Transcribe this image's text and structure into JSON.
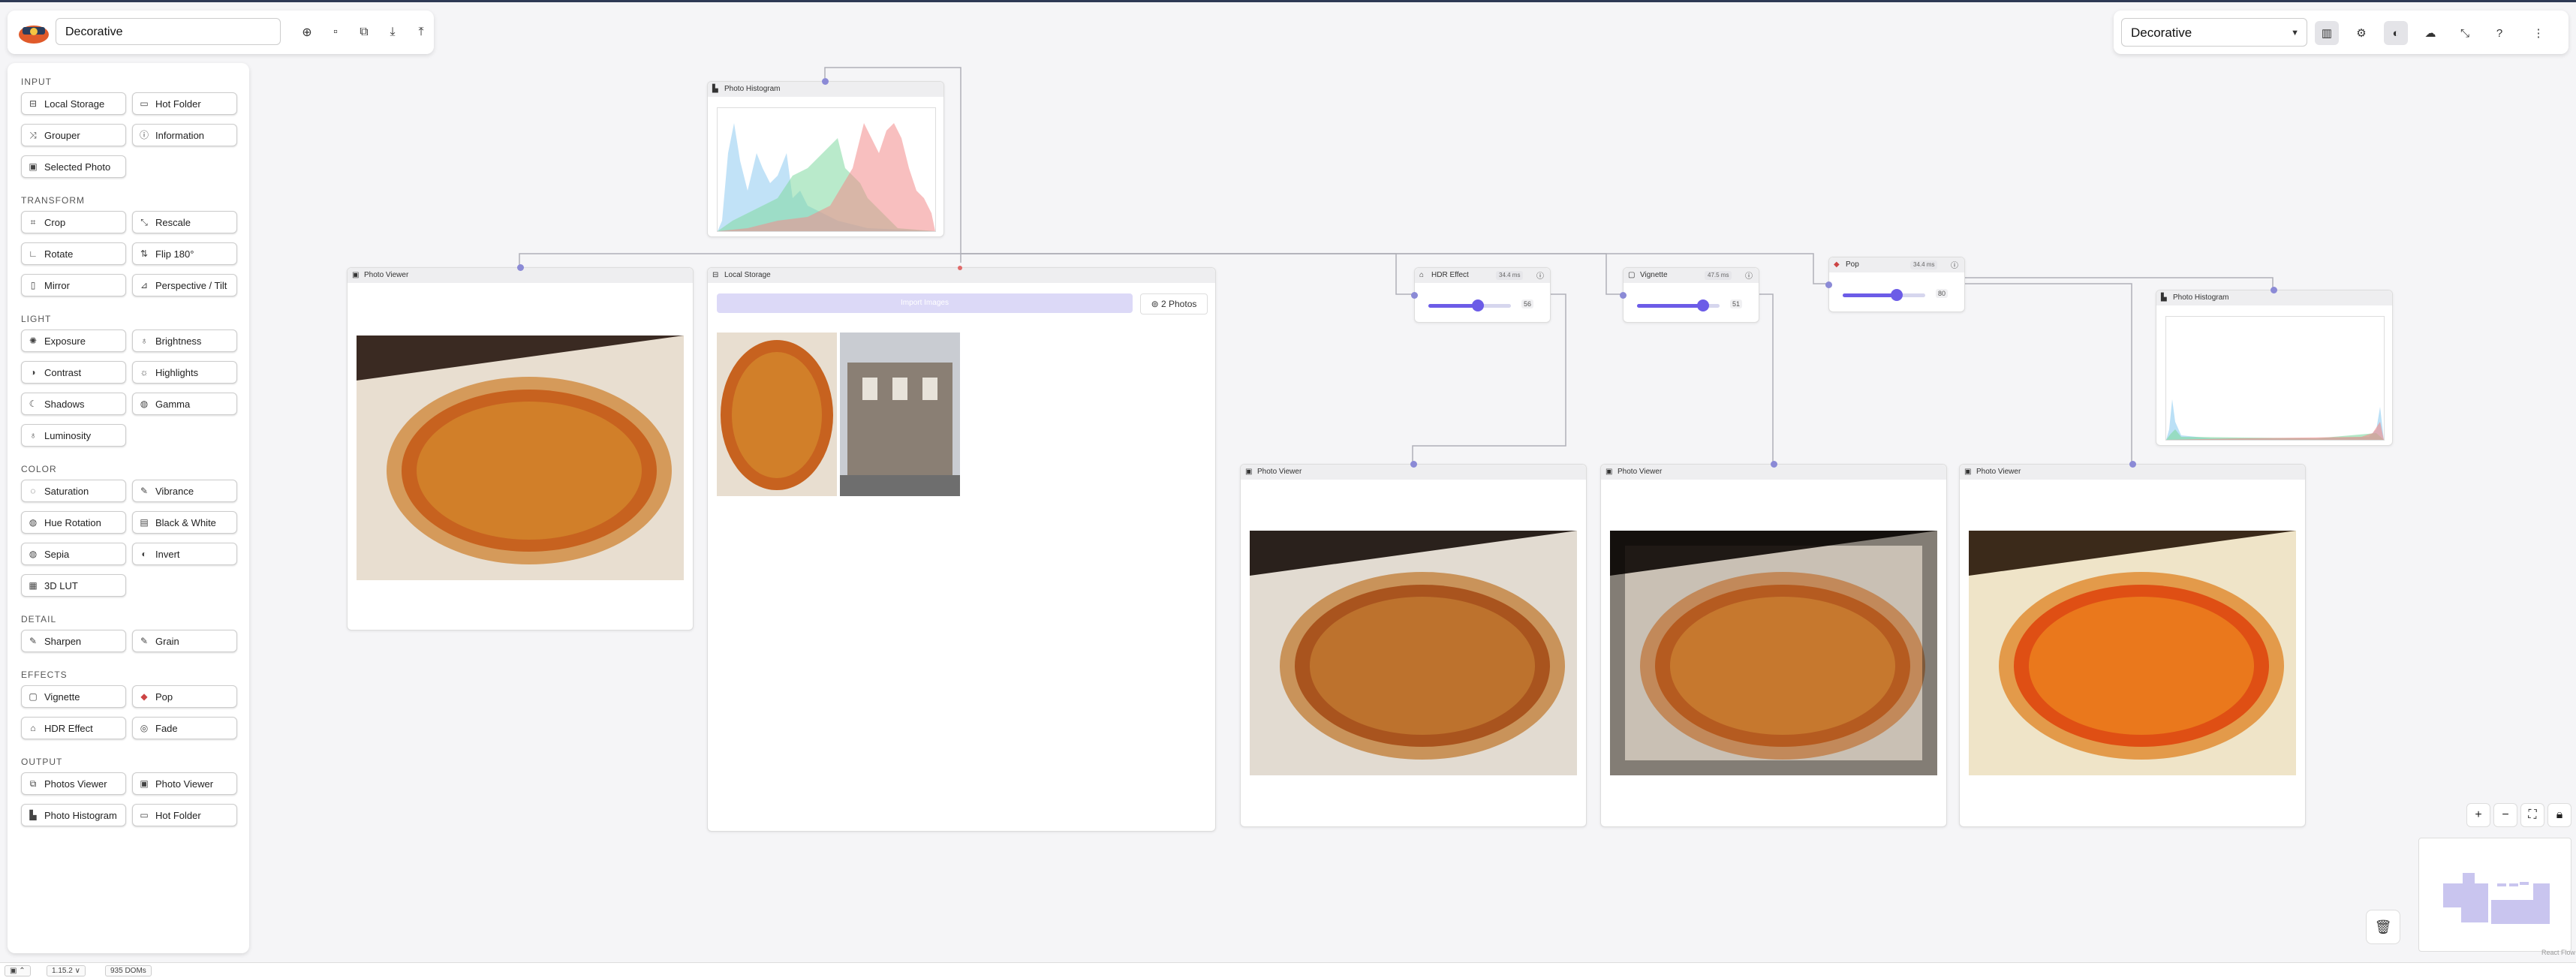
{
  "toolbar_left": {
    "project_name": "Decorative",
    "buttons": [
      "add-icon",
      "save-icon",
      "duplicate-icon",
      "download-icon",
      "upload-icon"
    ]
  },
  "toolbar_right": {
    "template_select": "Decorative",
    "buttons": [
      "layout-icon",
      "settings-icon",
      "theme-icon",
      "cloud-icon",
      "collapse-icon",
      "help-icon",
      "more-icon"
    ]
  },
  "sidebar": {
    "sections": [
      {
        "title": "INPUT",
        "items": [
          "Local Storage",
          "Hot Folder",
          "Grouper",
          "Information",
          "Selected Photo"
        ]
      },
      {
        "title": "TRANSFORM",
        "items": [
          "Crop",
          "Rescale",
          "Rotate",
          "Flip 180°",
          "Mirror",
          "Perspective / Tilt"
        ]
      },
      {
        "title": "LIGHT",
        "items": [
          "Exposure",
          "Brightness",
          "Contrast",
          "Highlights",
          "Shadows",
          "Gamma",
          "Luminosity"
        ]
      },
      {
        "title": "COLOR",
        "items": [
          "Saturation",
          "Vibrance",
          "Hue Rotation",
          "Black & White",
          "Sepia",
          "Invert",
          "3D LUT"
        ]
      },
      {
        "title": "DETAIL",
        "items": [
          "Sharpen",
          "Grain"
        ]
      },
      {
        "title": "EFFECTS",
        "items": [
          "Vignette",
          "Pop",
          "HDR Effect",
          "Fade"
        ]
      },
      {
        "title": "OUTPUT",
        "items": [
          "Photos Viewer",
          "Photo Viewer",
          "Photo Histogram",
          "Hot Folder"
        ]
      }
    ]
  },
  "nodes": {
    "histogram_top": {
      "title": "Photo Histogram"
    },
    "viewer_left": {
      "title": "Photo Viewer"
    },
    "local_storage": {
      "title": "Local Storage",
      "import_label": "Import Images",
      "photo_count": "2 Photos"
    },
    "hdr": {
      "title": "HDR Effect",
      "badge": "34.4 ms",
      "value": "56",
      "level": 0.6
    },
    "vignette": {
      "title": "Vignette",
      "badge": "47.5 ms",
      "value": "51",
      "level": 0.8
    },
    "pop": {
      "title": "Pop",
      "badge": "34.4 ms",
      "value": "80",
      "level": 0.65
    },
    "histogram_right": {
      "title": "Photo Histogram"
    },
    "viewer_1": {
      "title": "Photo Viewer"
    },
    "viewer_2": {
      "title": "Photo Viewer"
    },
    "viewer_3": {
      "title": "Photo Viewer"
    }
  },
  "zoom_controls": [
    "zoom-in-icon",
    "zoom-out-icon",
    "fit-view-icon",
    "lock-icon"
  ],
  "status_bar": {
    "version": "1.15.2 ∨",
    "dom_count": "935 DOMs"
  },
  "attribution": "React Flow",
  "colors": {
    "accent": "#6c5ce7",
    "handle": "#8b8ad6",
    "histogram_red": "#f28b8b",
    "histogram_green": "#7fd8a0",
    "histogram_blue": "#8ecbf0"
  }
}
